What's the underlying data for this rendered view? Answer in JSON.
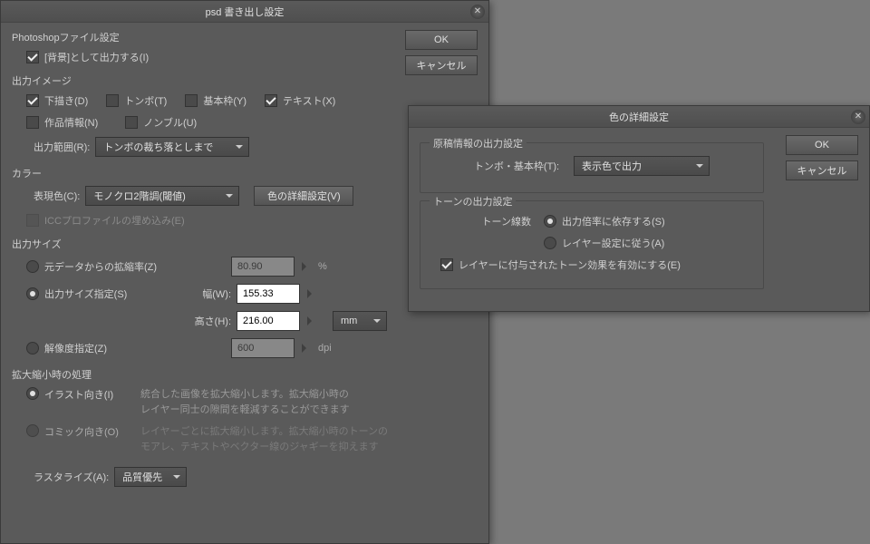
{
  "mainDialog": {
    "title": "psd 書き出し設定",
    "okBtn": "OK",
    "cancelBtn": "キャンセル",
    "psSection": "Photoshopファイル設定",
    "bgOutput": "[背景]として出力する(I)",
    "outputImage": "出力イメージ",
    "draft": "下描き(D)",
    "trim": "トンボ(T)",
    "frame": "基本枠(Y)",
    "text": "テキスト(X)",
    "workInfo": "作品情報(N)",
    "noble": "ノンブル(U)",
    "outputRangeLabel": "出力範囲(R):",
    "outputRangeValue": "トンボの裁ち落としまで",
    "colorSection": "カラー",
    "expressColorLabel": "表現色(C):",
    "expressColorValue": "モノクロ2階調(閾値)",
    "colorDetailBtn": "色の詳細設定(V)",
    "iccProfile": "ICCプロファイルの埋め込み(E)",
    "outputSize": "出力サイズ",
    "fromData": "元データからの拡縮率(Z)",
    "fromDataValue": "80.90",
    "sizeSpec": "出力サイズ指定(S)",
    "widthLabel": "幅(W):",
    "widthValue": "155.33",
    "heightLabel": "高さ(H):",
    "heightValue": "216.00",
    "unitValue": "mm",
    "resolution": "解像度指定(Z)",
    "resolutionValue": "600",
    "dpi": "dpi",
    "percent": "%",
    "resizeProc": "拡大縮小時の処理",
    "illust": "イラスト向き(I)",
    "illustDesc": "統合した画像を拡大縮小します。拡大縮小時の\nレイヤー同士の隙間を軽減することができます",
    "comic": "コミック向き(O)",
    "comicDesc": "レイヤーごとに拡大縮小します。拡大縮小時のトーンの\nモアレ、テキストやベクター線のジャギーを抑えます",
    "rasterizeLabel": "ラスタライズ(A):",
    "rasterizeValue": "品質優先"
  },
  "detailDialog": {
    "title": "色の詳細設定",
    "okBtn": "OK",
    "cancelBtn": "キャンセル",
    "origInfoSection": "原稿情報の出力設定",
    "trimFrameLabel": "トンボ・基本枠(T):",
    "trimFrameValue": "表示色で出力",
    "toneSection": "トーンの出力設定",
    "toneLineLabel": "トーン線数",
    "dependRatio": "出力倍率に依存する(S)",
    "followLayer": "レイヤー設定に従う(A)",
    "enableTone": "レイヤーに付与されたトーン効果を有効にする(E)"
  }
}
